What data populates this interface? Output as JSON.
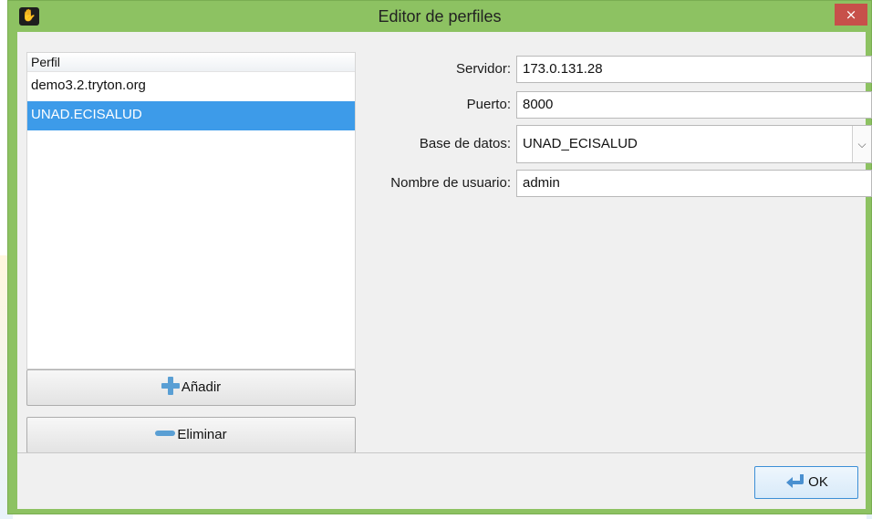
{
  "window": {
    "title": "Editor de perfiles",
    "close_glyph": "×",
    "app_icon": "tryton-hand-icon"
  },
  "profiles": {
    "header": "Perfil",
    "items": [
      {
        "label": "demo3.2.tryton.org",
        "selected": false
      },
      {
        "label": "UNAD.ECISALUD",
        "selected": true
      }
    ]
  },
  "buttons": {
    "add_label": "Añadir",
    "remove_label": "Eliminar",
    "ok_label": "OK"
  },
  "form": {
    "server_label": "Servidor:",
    "server_value": "173.0.131.28",
    "port_label": "Puerto:",
    "port_value": "8000",
    "database_label": "Base de datos:",
    "database_value": "UNAD_ECISALUD",
    "username_label": "Nombre de usuario:",
    "username_value": "admin"
  },
  "colors": {
    "titlebar": "#8dc262",
    "selection": "#3d9be9",
    "close": "#c7504a"
  }
}
